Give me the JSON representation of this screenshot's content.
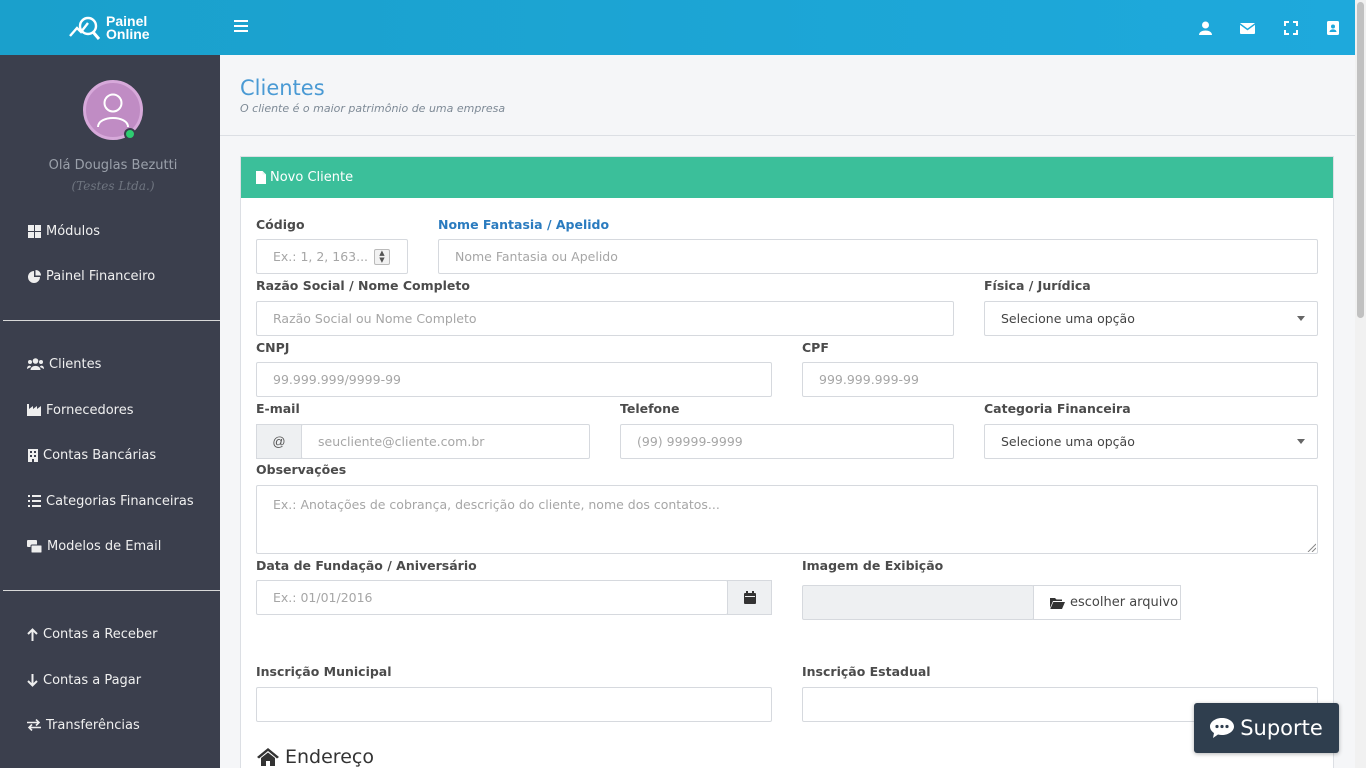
{
  "app": {
    "logo_line1": "Painel",
    "logo_line2": "Online"
  },
  "sidebar": {
    "greeting": "Olá Douglas Bezutti",
    "company": "(Testes Ltda.)",
    "items": [
      {
        "label": "Módulos",
        "icon": "grid-icon"
      },
      {
        "label": "Painel Financeiro",
        "icon": "pie-chart-icon"
      },
      {
        "label": "Clientes",
        "icon": "users-icon"
      },
      {
        "label": "Fornecedores",
        "icon": "industry-icon"
      },
      {
        "label": "Contas Bancárias",
        "icon": "building-icon"
      },
      {
        "label": "Categorias Financeiras",
        "icon": "list-icon"
      },
      {
        "label": "Modelos de Email",
        "icon": "mail-stack-icon"
      },
      {
        "label": "Contas a Receber",
        "icon": "arrow-up-icon"
      },
      {
        "label": "Contas a Pagar",
        "icon": "arrow-down-icon"
      },
      {
        "label": "Transferências",
        "icon": "exchange-icon"
      }
    ]
  },
  "header": {
    "title": "Clientes",
    "subtitle": "O cliente é o maior patrimônio de uma empresa"
  },
  "panel": {
    "title": "Novo Cliente"
  },
  "form": {
    "codigo": {
      "label": "Código",
      "placeholder": "Ex.: 1, 2, 163..."
    },
    "nome_fantasia": {
      "label": "Nome Fantasia / Apelido",
      "placeholder": "Nome Fantasia ou Apelido"
    },
    "razao_social": {
      "label": "Razão Social / Nome Completo",
      "placeholder": "Razão Social ou Nome Completo"
    },
    "tipo": {
      "label": "Física / Jurídica",
      "value": "Selecione uma opção"
    },
    "cnpj": {
      "label": "CNPJ",
      "placeholder": "99.999.999/9999-99"
    },
    "cpf": {
      "label": "CPF",
      "placeholder": "999.999.999-99"
    },
    "email": {
      "label": "E-mail",
      "addon": "@",
      "placeholder": "seucliente@cliente.com.br"
    },
    "telefone": {
      "label": "Telefone",
      "placeholder": "(99) 99999-9999"
    },
    "categoria": {
      "label": "Categoria Financeira",
      "value": "Selecione uma opção"
    },
    "observacoes": {
      "label": "Observações",
      "placeholder": "Ex.: Anotações de cobrança, descrição do cliente, nome dos contatos..."
    },
    "data_fundacao": {
      "label": "Data de Fundação / Aniversário",
      "placeholder": "Ex.: 01/01/2016"
    },
    "imagem": {
      "label": "Imagem de Exibição",
      "button": "escolher arquivo"
    },
    "inscricao_municipal": {
      "label": "Inscrição Municipal",
      "value": ""
    },
    "inscricao_estadual": {
      "label": "Inscrição Estadual",
      "value": ""
    },
    "endereco_title": "Endereço"
  },
  "support": {
    "label": "Suporte"
  },
  "colors": {
    "topbar": "#1ea9dc",
    "sidebar": "#3b3f4d",
    "panel_header": "#3bbf9a",
    "title_blue": "#4a9ad4",
    "support_bg": "#2f3e4e"
  }
}
